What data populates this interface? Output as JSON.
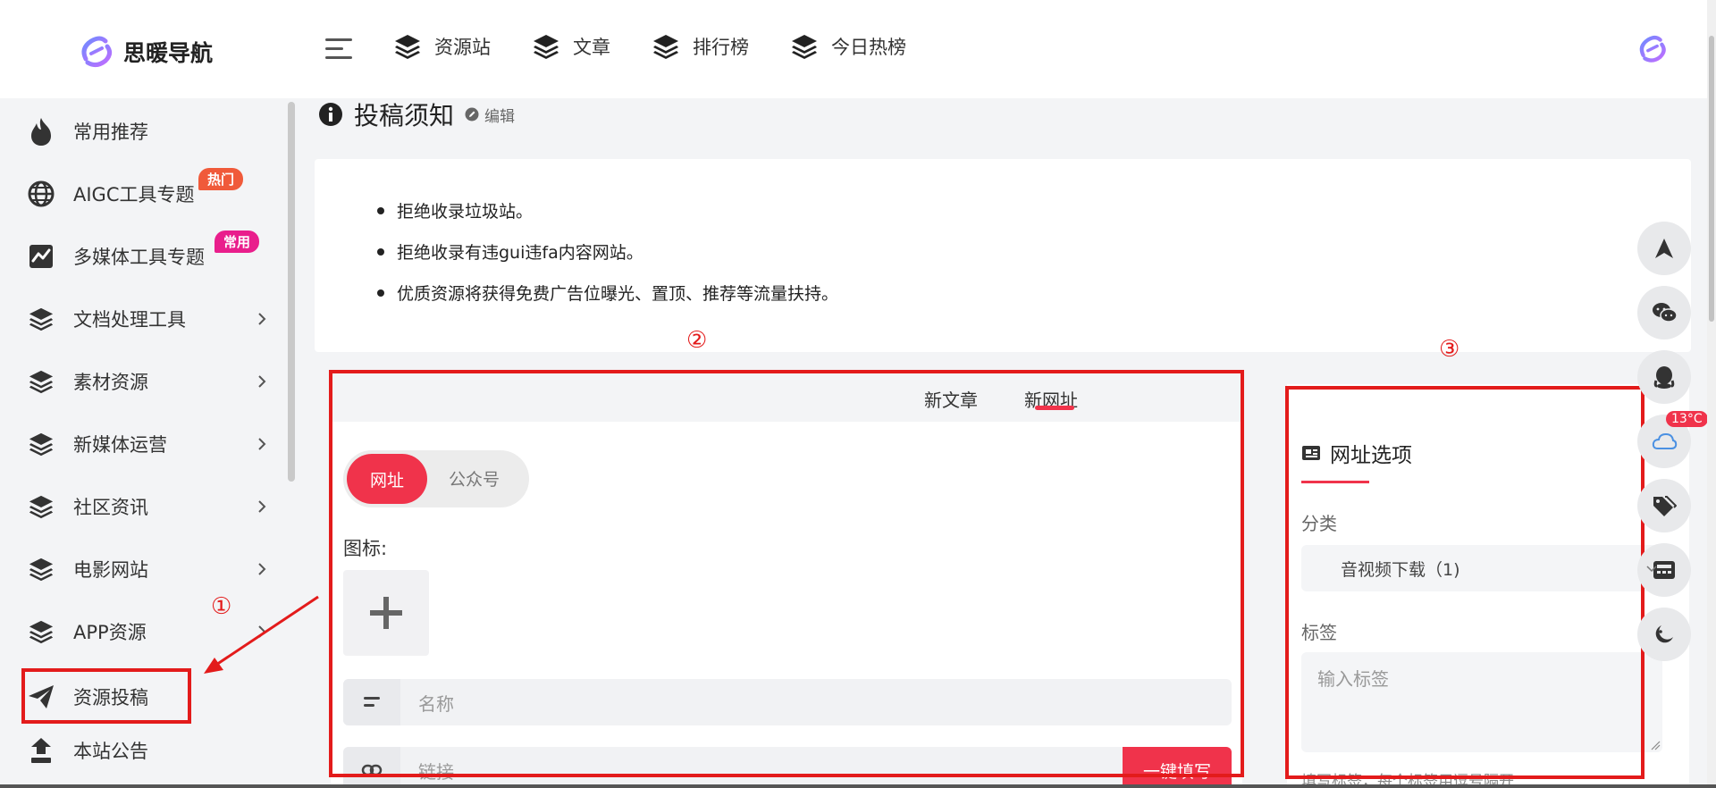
{
  "brand": {
    "name": "思暖导航"
  },
  "topnav": [
    {
      "label": "资源站"
    },
    {
      "label": "文章"
    },
    {
      "label": "排行榜"
    },
    {
      "label": "今日热榜"
    }
  ],
  "sidebar": {
    "items": [
      {
        "label": "常用推荐",
        "icon": "fire-icon"
      },
      {
        "label": "AIGC工具专题",
        "icon": "globe-icon",
        "badge": "热门",
        "badge_color": "#f05a3a"
      },
      {
        "label": "多媒体工具专题",
        "icon": "chart-icon",
        "badge": "常用",
        "badge_color": "#e91e8c"
      },
      {
        "label": "文档处理工具",
        "icon": "layers-icon"
      },
      {
        "label": "素材资源",
        "icon": "layers-icon"
      },
      {
        "label": "新媒体运营",
        "icon": "layers-icon"
      },
      {
        "label": "社区资讯",
        "icon": "layers-icon"
      },
      {
        "label": "电影网站",
        "icon": "layers-icon"
      },
      {
        "label": "APP资源",
        "icon": "layers-icon"
      },
      {
        "label": "资源投稿",
        "icon": "paper-plane-icon"
      },
      {
        "label": "本站公告",
        "icon": "notice-icon"
      }
    ]
  },
  "annotations": {
    "one": "①",
    "two": "②",
    "three": "③"
  },
  "page": {
    "title": "投稿须知",
    "edit_label": "编辑"
  },
  "notice": {
    "items": [
      "拒绝收录垃圾站。",
      "拒绝收录有违gui违fa内容网站。",
      "优质资源将获得免费广告位曝光、置顶、推荐等流量扶持。"
    ]
  },
  "form": {
    "tabs": [
      "新文章",
      "新网址"
    ],
    "active_tab": "新网址",
    "type_toggle": {
      "active": "网址",
      "inactive": "公众号"
    },
    "icon_label": "图标:",
    "name_placeholder": "名称",
    "link_placeholder": "链接",
    "fill_button": "一键填写"
  },
  "options": {
    "title": "网址选项",
    "category_label": "分类",
    "category_value": "音视频下载（1)",
    "tags_label": "标签",
    "tags_placeholder": "输入标签",
    "hint": "填写标签，每个标签用逗号隔开"
  },
  "weather": {
    "temp": "13°C"
  },
  "colors": {
    "accent": "#f0334b",
    "annotation": "#e31b1b"
  }
}
